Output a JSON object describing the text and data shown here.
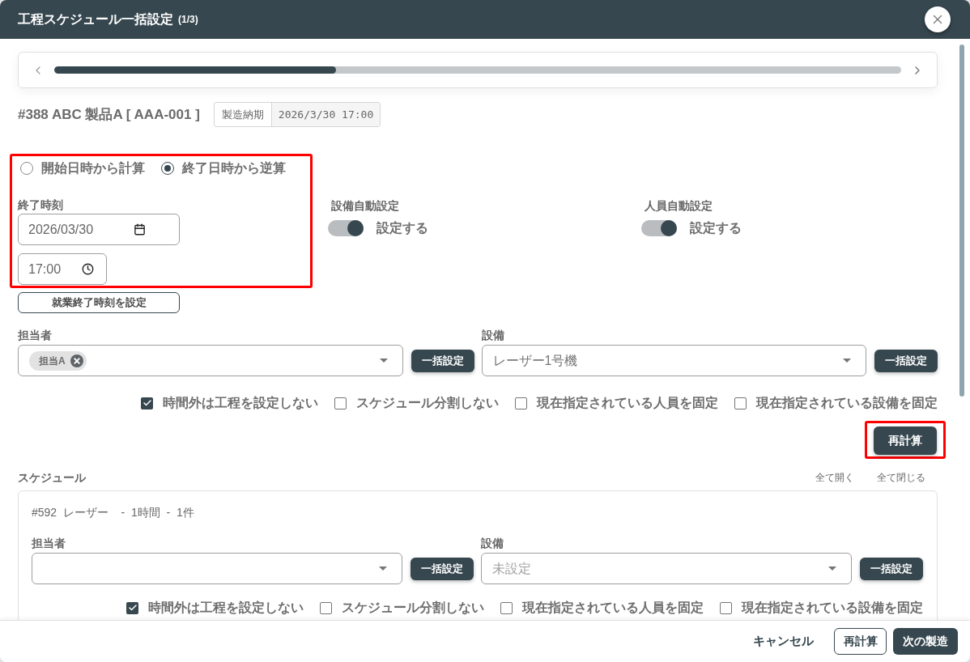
{
  "dialog": {
    "title": "工程スケジュール一括設定",
    "counter": "(1/3)"
  },
  "progress": {
    "level": 0.333
  },
  "order": {
    "title": "#388 ABC 製品A [ AAA-001 ]",
    "due_label": "製造納期",
    "due_value": "2026/3/30 17:00"
  },
  "calc_mode": {
    "highlighted": true,
    "options": [
      {
        "label": "開始日時から計算",
        "selected": false
      },
      {
        "label": "終了日時から逆算",
        "selected": true
      }
    ],
    "time_label": "終了時刻",
    "date_value": "2026/03/30",
    "time_value": "17:00"
  },
  "set_end_button": "就業終了時刻を設定",
  "auto_settings": [
    {
      "label": "設備自動設定",
      "on": true,
      "text": "設定する"
    },
    {
      "label": "人員自動設定",
      "on": true,
      "text": "設定する"
    }
  ],
  "assignment": {
    "fields": [
      {
        "kind": "chips",
        "label": "担当者",
        "chips": [
          "担当A"
        ],
        "button": "一括設定"
      },
      {
        "kind": "select",
        "label": "設備",
        "value": "レーザー1号機",
        "button": "一括設定"
      }
    ],
    "options": [
      {
        "label": "時間外は工程を設定しない",
        "checked": true
      },
      {
        "label": "スケジュール分割しない",
        "checked": false
      },
      {
        "label": "現在指定されている人員を固定",
        "checked": false
      },
      {
        "label": "現在指定されている設備を固定",
        "checked": false
      }
    ]
  },
  "recalc_button": {
    "label": "再計算",
    "highlighted": true
  },
  "schedule": {
    "title": "スケジュール",
    "expand_all": "全て開く",
    "collapse_all": "全て閉じる",
    "items": [
      {
        "heading": "#592  レーザー    -  1時間  -  1件",
        "fields": [
          {
            "kind": "select",
            "label": "担当者",
            "button": "一括設定"
          },
          {
            "kind": "select",
            "label": "設備",
            "placeholder": "未設定",
            "button": "一括設定"
          }
        ],
        "options": [
          {
            "label": "時間外は工程を設定しない",
            "checked": true
          },
          {
            "label": "スケジュール分割しない",
            "checked": false
          },
          {
            "label": "現在指定されている人員を固定",
            "checked": false
          },
          {
            "label": "現在指定されている設備を固定",
            "checked": false
          }
        ]
      }
    ]
  },
  "footer": {
    "buttons": [
      {
        "kind": "text",
        "label": "キャンセル"
      },
      {
        "kind": "outline",
        "label": "再計算"
      },
      {
        "kind": "primary",
        "label": "次の製造"
      }
    ]
  }
}
